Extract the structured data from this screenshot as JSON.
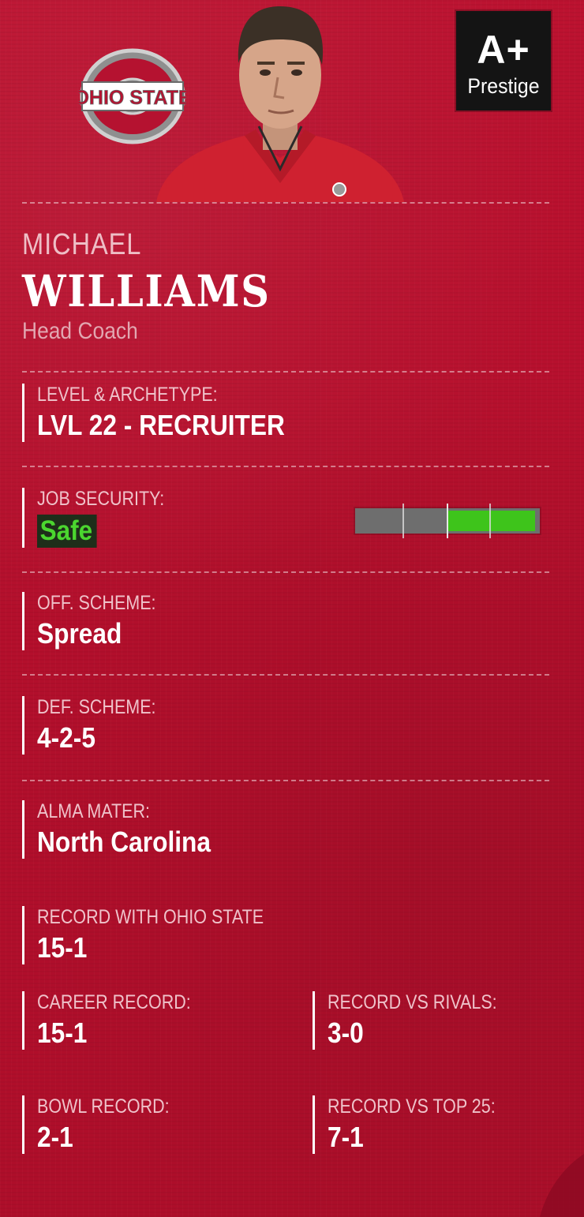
{
  "header": {
    "team_logo_icon": "ohio-state-block-o-logo",
    "portrait_icon": "coach-portrait",
    "prestige": {
      "grade": "A+",
      "label": "Prestige"
    }
  },
  "coach": {
    "first_name": "MICHAEL",
    "last_name": "WILLIAMS",
    "role": "Head Coach"
  },
  "details": {
    "level_archetype": {
      "label": "LEVEL & ARCHETYPE:",
      "value": "LVL 22 - RECRUITER"
    },
    "job_security": {
      "label": "JOB SECURITY:",
      "value": "Safe",
      "meter_level": 0.5
    },
    "off_scheme": {
      "label": "OFF. SCHEME:",
      "value": "Spread"
    },
    "def_scheme": {
      "label": "DEF. SCHEME:",
      "value": "4-2-5"
    },
    "alma_mater": {
      "label": "ALMA MATER:",
      "value": "North Carolina"
    },
    "record_with_team": {
      "label": "RECORD WITH OHIO STATE",
      "value": "15-1"
    },
    "career_record": {
      "label": "CAREER RECORD:",
      "value": "15-1"
    },
    "record_vs_rivals": {
      "label": "RECORD VS RIVALS:",
      "value": "3-0"
    },
    "bowl_record": {
      "label": "BOWL RECORD:",
      "value": "2-1"
    },
    "record_vs_top25": {
      "label": "RECORD VS TOP 25:",
      "value": "7-1"
    }
  },
  "colors": {
    "background": "#b8102e",
    "safe_text": "#4bd62f",
    "meter_fill": "#3ec41b",
    "badge": "#141414"
  }
}
